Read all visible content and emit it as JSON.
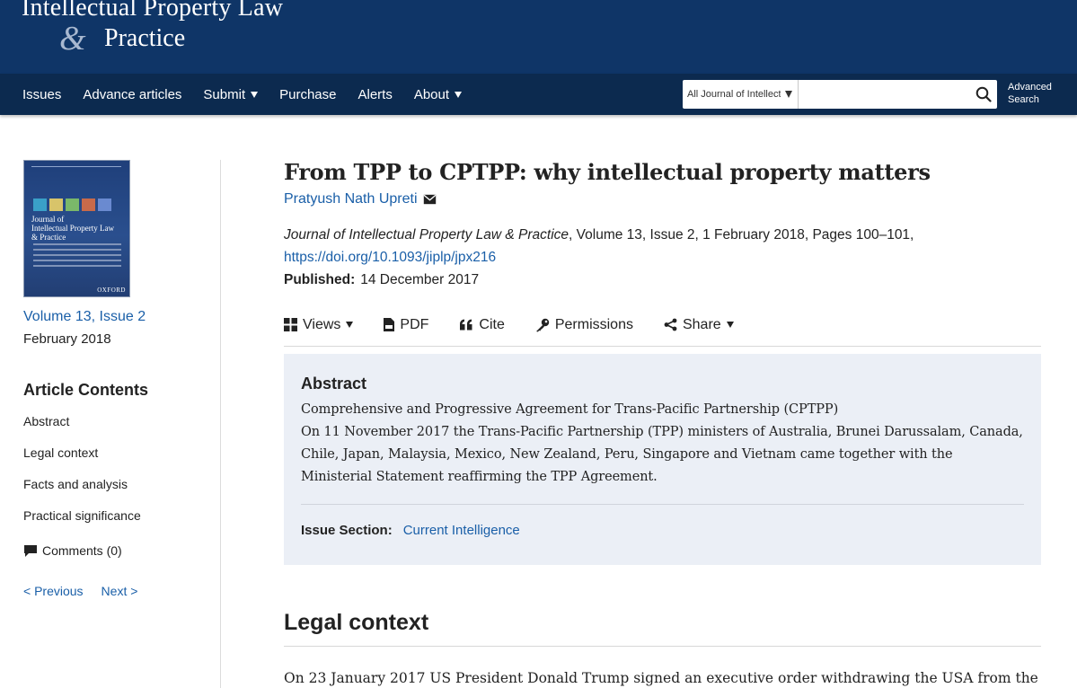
{
  "journal": {
    "logo_line1": "Intellectual Property Law",
    "logo_amp": "&",
    "logo_line2": "Practice"
  },
  "nav": {
    "items": [
      {
        "label": "Issues",
        "dropdown": false
      },
      {
        "label": "Advance articles",
        "dropdown": false
      },
      {
        "label": "Submit",
        "dropdown": true
      },
      {
        "label": "Purchase",
        "dropdown": false
      },
      {
        "label": "Alerts",
        "dropdown": false
      },
      {
        "label": "About",
        "dropdown": true
      }
    ]
  },
  "search": {
    "scope": "All Journal of Intellectual Property Law & Practice",
    "placeholder": "",
    "advanced_line1": "Advanced",
    "advanced_line2": "Search"
  },
  "sidebar": {
    "cover": {
      "title_line1": "Journal of",
      "title_line2": "Intellectual Property Law",
      "title_line3": "& Practice",
      "publisher": "OXFORD"
    },
    "issue_label": "Volume 13, Issue 2",
    "issue_date": "February 2018",
    "contents_heading": "Article Contents",
    "contents": [
      "Abstract",
      "Legal context",
      "Facts and analysis",
      "Practical significance"
    ],
    "comments_label": "Comments (0)",
    "prev_label": "< Previous",
    "next_label": "Next >"
  },
  "article": {
    "title": "From TPP to CPTPP: why intellectual property matters",
    "author": "Pratyush Nath Upreti",
    "citation_journal": "Journal of Intellectual Property Law & Practice",
    "citation_rest": ", Volume 13, Issue 2, 1 February 2018, Pages 100–101,",
    "doi": "https://doi.org/10.1093/jiplp/jpx216",
    "published_label": "Published:",
    "published_date": "14 December 2017"
  },
  "tools": {
    "views": "Views",
    "pdf": "PDF",
    "cite": "Cite",
    "permissions": "Permissions",
    "share": "Share"
  },
  "abstract": {
    "heading": "Abstract",
    "line1": "Comprehensive and Progressive Agreement for Trans-Pacific Partnership (CPTPP)",
    "line2": "On 11 November 2017 the Trans-Pacific Partnership (TPP) ministers of Australia, Brunei Darussalam, Canada, Chile, Japan, Malaysia, Mexico, New Zealand, Peru, Singapore and Vietnam came together with the Ministerial Statement reaffirming the TPP Agreement.",
    "issue_section_label": "Issue Section:",
    "issue_section_value": "Current Intelligence"
  },
  "legal_context": {
    "heading": "Legal context",
    "first_line": "On 23 January 2017 US President Donald Trump signed an executive order withdrawing the USA from the"
  },
  "colors": {
    "header_bg": "#0f3567",
    "nav_bg": "#0c2a4f",
    "link": "#1a5fa8",
    "abstract_bg": "#ebeff6"
  }
}
